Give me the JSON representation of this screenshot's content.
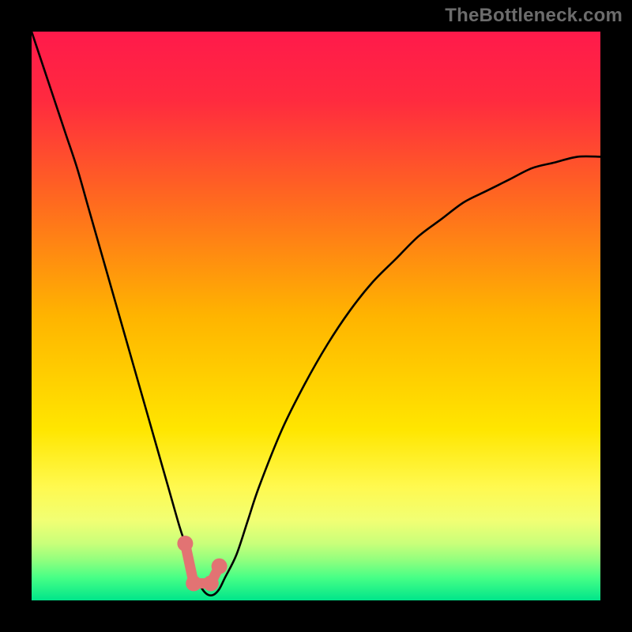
{
  "watermark": "TheBottleneck.com",
  "chart_data": {
    "type": "line",
    "title": "",
    "xlabel": "",
    "ylabel": "",
    "xlim": [
      0,
      100
    ],
    "ylim": [
      0,
      100
    ],
    "background_gradient": {
      "stops": [
        {
          "offset": 0.0,
          "color": "#ff1a4b"
        },
        {
          "offset": 0.12,
          "color": "#ff2a3f"
        },
        {
          "offset": 0.3,
          "color": "#ff6a1f"
        },
        {
          "offset": 0.5,
          "color": "#ffb400"
        },
        {
          "offset": 0.7,
          "color": "#ffe600"
        },
        {
          "offset": 0.8,
          "color": "#fff94f"
        },
        {
          "offset": 0.86,
          "color": "#f1ff74"
        },
        {
          "offset": 0.9,
          "color": "#c9ff7a"
        },
        {
          "offset": 0.93,
          "color": "#8fff7e"
        },
        {
          "offset": 0.96,
          "color": "#47ff86"
        },
        {
          "offset": 1.0,
          "color": "#00e58a"
        }
      ]
    },
    "series": [
      {
        "name": "bottleneck-curve",
        "x": [
          0,
          2,
          4,
          6,
          8,
          10,
          12,
          14,
          16,
          18,
          20,
          22,
          24,
          26,
          27,
          28,
          29,
          30,
          31,
          32,
          33,
          34,
          36,
          38,
          40,
          44,
          48,
          52,
          56,
          60,
          64,
          68,
          72,
          76,
          80,
          84,
          88,
          92,
          96,
          100
        ],
        "y": [
          100,
          94,
          88,
          82,
          76,
          69,
          62,
          55,
          48,
          41,
          34,
          27,
          20,
          13,
          10,
          7,
          4,
          2,
          1,
          1,
          2,
          4,
          8,
          14,
          20,
          30,
          38,
          45,
          51,
          56,
          60,
          64,
          67,
          70,
          72,
          74,
          76,
          77,
          78,
          78
        ]
      }
    ],
    "markers": [
      {
        "name": "marker-left",
        "x": 27.0,
        "y": 10.0
      },
      {
        "name": "marker-mid-a",
        "x": 28.5,
        "y": 3.0
      },
      {
        "name": "marker-mid-b",
        "x": 31.5,
        "y": 3.0
      },
      {
        "name": "marker-right",
        "x": 33.0,
        "y": 6.0
      }
    ],
    "marker_link_path": [
      {
        "x": 27.0,
        "y": 10.0
      },
      {
        "x": 28.5,
        "y": 3.0
      },
      {
        "x": 31.5,
        "y": 3.0
      },
      {
        "x": 33.0,
        "y": 6.0
      }
    ]
  }
}
